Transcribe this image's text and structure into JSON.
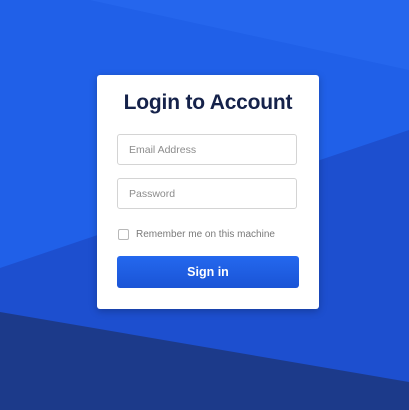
{
  "colors": {
    "background_top": "#2060e8",
    "background_mid": "#1d4fcf",
    "background_bottom": "#1c3a8a",
    "title": "#15224a",
    "button": "#1f5fe6"
  },
  "login": {
    "title": "Login to Account",
    "email_placeholder": "Email Address",
    "email_value": "",
    "password_placeholder": "Password",
    "password_value": "",
    "remember_label": "Remember me on this machine",
    "remember_checked": false,
    "signin_label": "Sign in"
  }
}
